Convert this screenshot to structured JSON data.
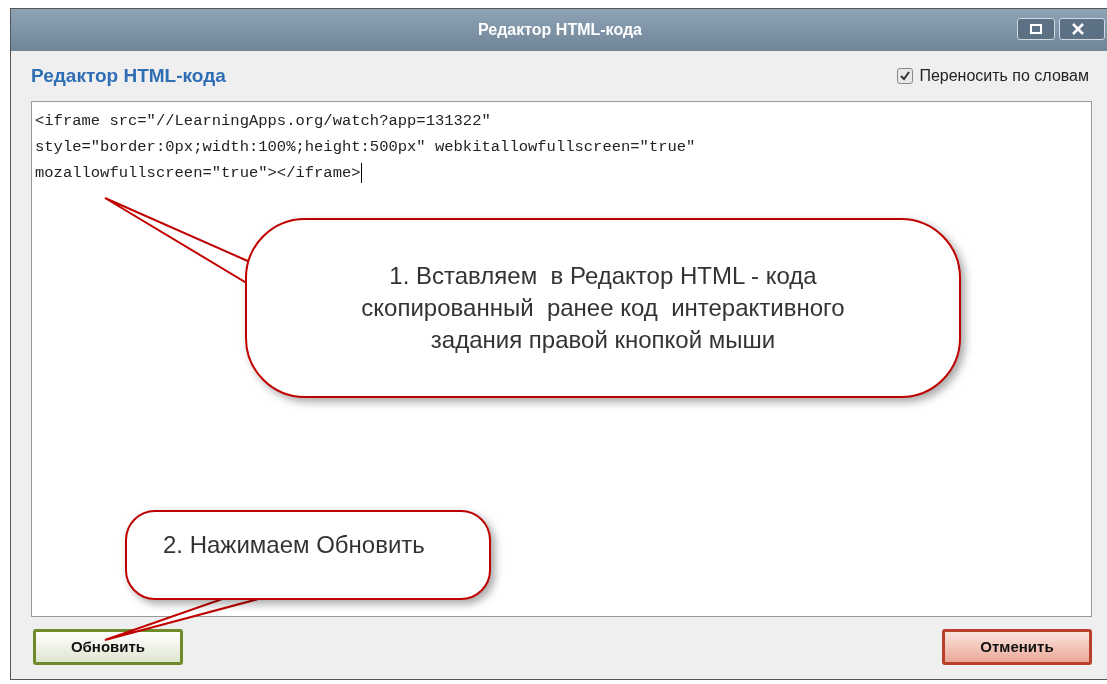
{
  "window": {
    "title": "Редактор HTML-кода"
  },
  "heading": "Редактор HTML-кода",
  "word_wrap": {
    "label": "Переносить по словам",
    "checked": true
  },
  "editor": {
    "lines": [
      "<iframe src=\"//LearningApps.org/watch?app=131322\"",
      "style=\"border:0px;width:100%;height:500px\" webkitallowfullscreen=\"true\"",
      "mozallowfullscreen=\"true\"></iframe>"
    ]
  },
  "callouts": [
    "1. Вставляем  в Редактор HTML - кода\nскопированный  ранее код  интерактивного\nзадания правой кнопкой мыши",
    "2. Нажимаем Обновить"
  ],
  "buttons": [
    {
      "label": "Обновить",
      "kind": "confirm"
    },
    {
      "label": "Отменить",
      "kind": "cancel"
    }
  ]
}
